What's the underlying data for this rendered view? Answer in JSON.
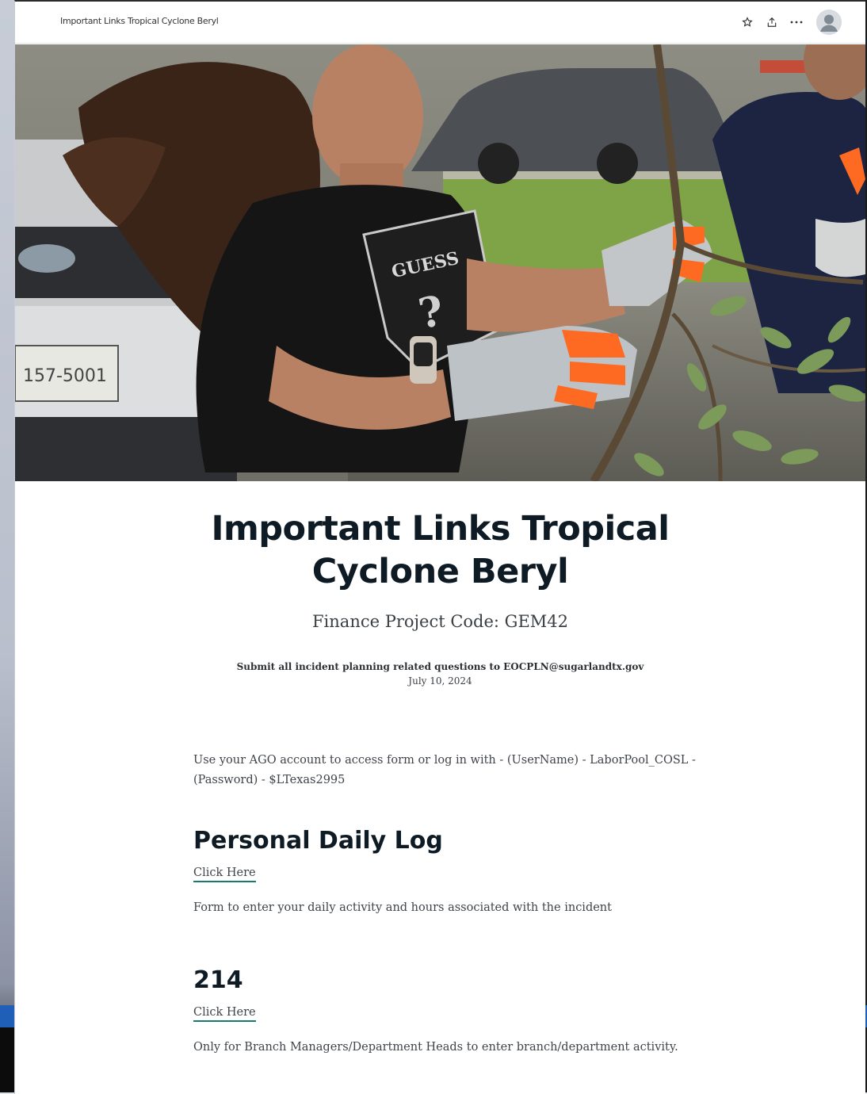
{
  "site": {
    "title": "Important Links Tropical Cyclone Beryl"
  },
  "toolbar": {
    "icons": [
      "star-icon",
      "share-icon",
      "more-icon",
      "avatar"
    ]
  },
  "hero": {
    "plate": "157-5001",
    "shirt_text": "GUESS"
  },
  "main": {
    "title_line1": "Important Links Tropical",
    "title_line2": "Cyclone Beryl",
    "subtitle": "Finance Project Code: GEM42",
    "notice": "Submit all incident planning related questions to EOCPLN@sugarlandtx.gov",
    "date": "July 10, 2024",
    "access_line1": "Use your AGO account to access form or log in with - (UserName) - LaborPool_COSL -",
    "access_line2": "(Password) - $LTexas2995",
    "sections": [
      {
        "heading": "Personal Daily Log",
        "link_label": "Click Here",
        "description": "Form to enter your daily activity and hours associated with the incident"
      },
      {
        "heading": "214",
        "link_label": "Click Here",
        "description": "Only for Branch Managers/Department Heads to enter branch/department activity."
      }
    ]
  },
  "colors": {
    "title": "#0e1b24",
    "link_underline": "#1a7a73",
    "page_bg": "#ffffff"
  }
}
